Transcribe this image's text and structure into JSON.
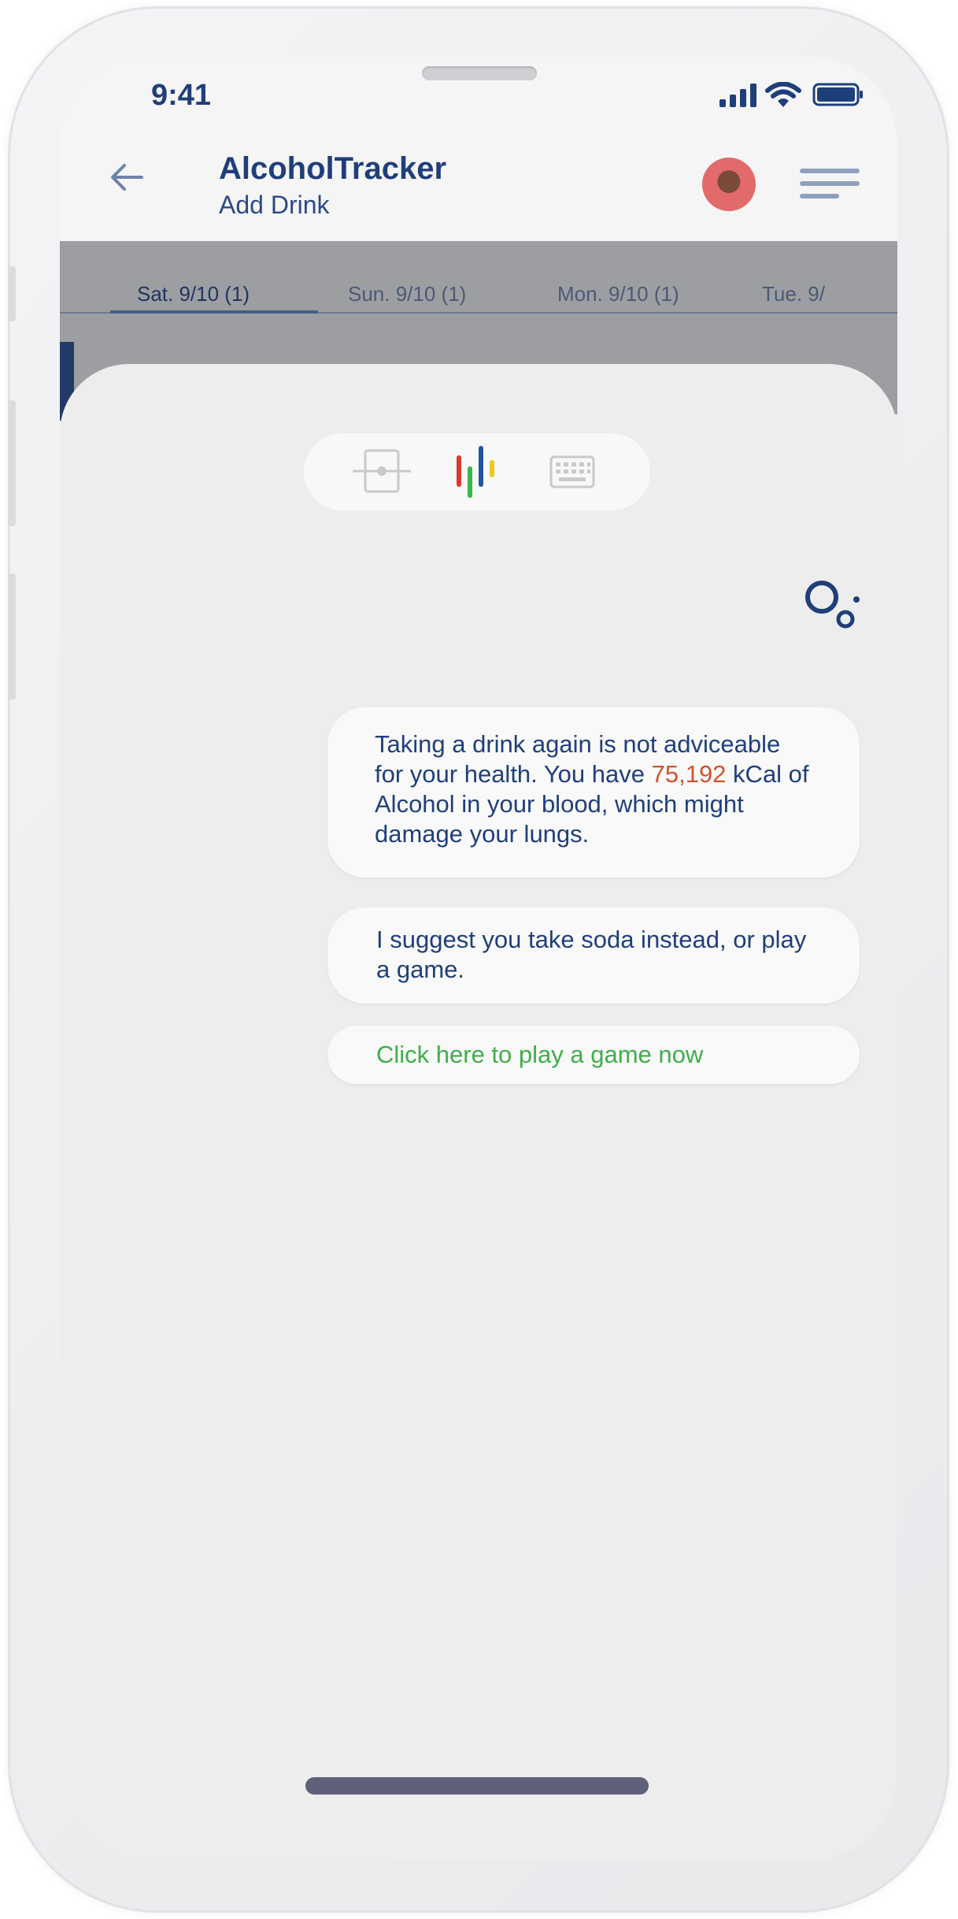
{
  "status_bar": {
    "time": "9:41",
    "icons": [
      "signal-icon",
      "wifi-icon",
      "battery-icon"
    ]
  },
  "app_bar": {
    "back_icon": "back-arrow-icon",
    "title": "AlcoholTracker",
    "subtitle": "Add Drink",
    "avatar": "user-avatar",
    "menu_icon": "hamburger-menu-icon"
  },
  "day_tabs": [
    {
      "label": "Sat. 9/10 (1)",
      "active": true
    },
    {
      "label": "Sun. 9/10 (1)",
      "active": false
    },
    {
      "label": "Mon. 9/10 (1)",
      "active": false
    },
    {
      "label": "Tue. 9/",
      "active": false
    }
  ],
  "input_modes": {
    "icons": [
      "scan-icon",
      "voice-bars-icon",
      "keyboard-icon"
    ],
    "active": "voice-bars-icon"
  },
  "assistant_icon": "assistant-logo-icon",
  "messages": {
    "warning": {
      "part1": "Taking a drink again is not adviceable for your health. You have ",
      "highlight": "75,192",
      "part2": " kCal of Alcohol in your blood, which might damage your lungs."
    },
    "suggestion": "I suggest you take soda instead, or play a game.",
    "action_link": "Click here to play a game now"
  },
  "colors": {
    "primary": "#1f3f7a",
    "highlight": "#d0532f",
    "link": "#3fae4a",
    "voice_red": "#e2362f",
    "voice_green": "#34b84a",
    "voice_blue": "#2453a6",
    "voice_yellow": "#f2c718"
  }
}
